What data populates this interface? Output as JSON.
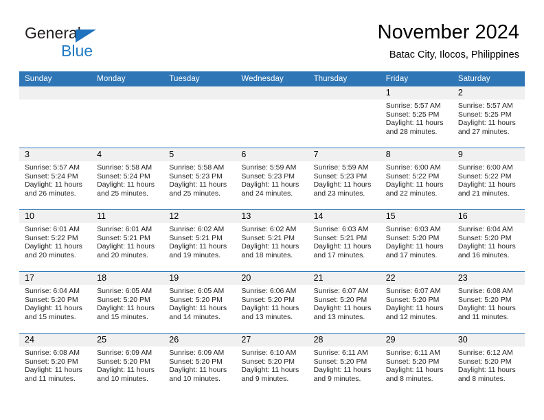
{
  "brand": {
    "name_top": "General",
    "name_bottom": "Blue",
    "triangle_color": "#1f72bd",
    "text_color": "#231f20",
    "blue_text_color": "#1f7ac4"
  },
  "header": {
    "title": "November 2024",
    "subtitle": "Batac City, Ilocos, Philippines"
  },
  "theme": {
    "header_bg": "#2f76b6",
    "header_text": "#ffffff",
    "daynum_bg": "#f0f0f0",
    "divider": "#2f76b6"
  },
  "labels": {
    "sunrise_prefix": "Sunrise:",
    "sunset_prefix": "Sunset:",
    "daylight_prefix": "Daylight:"
  },
  "weekdays": [
    "Sunday",
    "Monday",
    "Tuesday",
    "Wednesday",
    "Thursday",
    "Friday",
    "Saturday"
  ],
  "weeks": [
    [
      {
        "day": "",
        "lines": []
      },
      {
        "day": "",
        "lines": []
      },
      {
        "day": "",
        "lines": []
      },
      {
        "day": "",
        "lines": []
      },
      {
        "day": "",
        "lines": []
      },
      {
        "day": "1",
        "lines": [
          "Sunrise: 5:57 AM",
          "Sunset: 5:25 PM",
          "Daylight: 11 hours",
          "and 28 minutes."
        ]
      },
      {
        "day": "2",
        "lines": [
          "Sunrise: 5:57 AM",
          "Sunset: 5:25 PM",
          "Daylight: 11 hours",
          "and 27 minutes."
        ]
      }
    ],
    [
      {
        "day": "3",
        "lines": [
          "Sunrise: 5:57 AM",
          "Sunset: 5:24 PM",
          "Daylight: 11 hours",
          "and 26 minutes."
        ]
      },
      {
        "day": "4",
        "lines": [
          "Sunrise: 5:58 AM",
          "Sunset: 5:24 PM",
          "Daylight: 11 hours",
          "and 25 minutes."
        ]
      },
      {
        "day": "5",
        "lines": [
          "Sunrise: 5:58 AM",
          "Sunset: 5:23 PM",
          "Daylight: 11 hours",
          "and 25 minutes."
        ]
      },
      {
        "day": "6",
        "lines": [
          "Sunrise: 5:59 AM",
          "Sunset: 5:23 PM",
          "Daylight: 11 hours",
          "and 24 minutes."
        ]
      },
      {
        "day": "7",
        "lines": [
          "Sunrise: 5:59 AM",
          "Sunset: 5:23 PM",
          "Daylight: 11 hours",
          "and 23 minutes."
        ]
      },
      {
        "day": "8",
        "lines": [
          "Sunrise: 6:00 AM",
          "Sunset: 5:22 PM",
          "Daylight: 11 hours",
          "and 22 minutes."
        ]
      },
      {
        "day": "9",
        "lines": [
          "Sunrise: 6:00 AM",
          "Sunset: 5:22 PM",
          "Daylight: 11 hours",
          "and 21 minutes."
        ]
      }
    ],
    [
      {
        "day": "10",
        "lines": [
          "Sunrise: 6:01 AM",
          "Sunset: 5:22 PM",
          "Daylight: 11 hours",
          "and 20 minutes."
        ]
      },
      {
        "day": "11",
        "lines": [
          "Sunrise: 6:01 AM",
          "Sunset: 5:21 PM",
          "Daylight: 11 hours",
          "and 20 minutes."
        ]
      },
      {
        "day": "12",
        "lines": [
          "Sunrise: 6:02 AM",
          "Sunset: 5:21 PM",
          "Daylight: 11 hours",
          "and 19 minutes."
        ]
      },
      {
        "day": "13",
        "lines": [
          "Sunrise: 6:02 AM",
          "Sunset: 5:21 PM",
          "Daylight: 11 hours",
          "and 18 minutes."
        ]
      },
      {
        "day": "14",
        "lines": [
          "Sunrise: 6:03 AM",
          "Sunset: 5:21 PM",
          "Daylight: 11 hours",
          "and 17 minutes."
        ]
      },
      {
        "day": "15",
        "lines": [
          "Sunrise: 6:03 AM",
          "Sunset: 5:20 PM",
          "Daylight: 11 hours",
          "and 17 minutes."
        ]
      },
      {
        "day": "16",
        "lines": [
          "Sunrise: 6:04 AM",
          "Sunset: 5:20 PM",
          "Daylight: 11 hours",
          "and 16 minutes."
        ]
      }
    ],
    [
      {
        "day": "17",
        "lines": [
          "Sunrise: 6:04 AM",
          "Sunset: 5:20 PM",
          "Daylight: 11 hours",
          "and 15 minutes."
        ]
      },
      {
        "day": "18",
        "lines": [
          "Sunrise: 6:05 AM",
          "Sunset: 5:20 PM",
          "Daylight: 11 hours",
          "and 15 minutes."
        ]
      },
      {
        "day": "19",
        "lines": [
          "Sunrise: 6:05 AM",
          "Sunset: 5:20 PM",
          "Daylight: 11 hours",
          "and 14 minutes."
        ]
      },
      {
        "day": "20",
        "lines": [
          "Sunrise: 6:06 AM",
          "Sunset: 5:20 PM",
          "Daylight: 11 hours",
          "and 13 minutes."
        ]
      },
      {
        "day": "21",
        "lines": [
          "Sunrise: 6:07 AM",
          "Sunset: 5:20 PM",
          "Daylight: 11 hours",
          "and 13 minutes."
        ]
      },
      {
        "day": "22",
        "lines": [
          "Sunrise: 6:07 AM",
          "Sunset: 5:20 PM",
          "Daylight: 11 hours",
          "and 12 minutes."
        ]
      },
      {
        "day": "23",
        "lines": [
          "Sunrise: 6:08 AM",
          "Sunset: 5:20 PM",
          "Daylight: 11 hours",
          "and 11 minutes."
        ]
      }
    ],
    [
      {
        "day": "24",
        "lines": [
          "Sunrise: 6:08 AM",
          "Sunset: 5:20 PM",
          "Daylight: 11 hours",
          "and 11 minutes."
        ]
      },
      {
        "day": "25",
        "lines": [
          "Sunrise: 6:09 AM",
          "Sunset: 5:20 PM",
          "Daylight: 11 hours",
          "and 10 minutes."
        ]
      },
      {
        "day": "26",
        "lines": [
          "Sunrise: 6:09 AM",
          "Sunset: 5:20 PM",
          "Daylight: 11 hours",
          "and 10 minutes."
        ]
      },
      {
        "day": "27",
        "lines": [
          "Sunrise: 6:10 AM",
          "Sunset: 5:20 PM",
          "Daylight: 11 hours",
          "and 9 minutes."
        ]
      },
      {
        "day": "28",
        "lines": [
          "Sunrise: 6:11 AM",
          "Sunset: 5:20 PM",
          "Daylight: 11 hours",
          "and 9 minutes."
        ]
      },
      {
        "day": "29",
        "lines": [
          "Sunrise: 6:11 AM",
          "Sunset: 5:20 PM",
          "Daylight: 11 hours",
          "and 8 minutes."
        ]
      },
      {
        "day": "30",
        "lines": [
          "Sunrise: 6:12 AM",
          "Sunset: 5:20 PM",
          "Daylight: 11 hours",
          "and 8 minutes."
        ]
      }
    ]
  ]
}
